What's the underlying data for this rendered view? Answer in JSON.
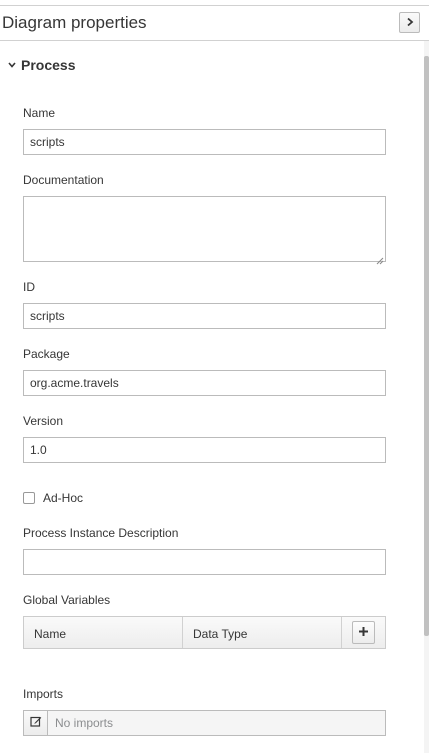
{
  "panel": {
    "title": "Diagram properties",
    "collapse_icon": "chevron-right-icon"
  },
  "section": {
    "title": "Process",
    "toggle_icon": "chevron-down-icon",
    "expanded": true
  },
  "fields": {
    "name": {
      "label": "Name",
      "value": "scripts"
    },
    "documentation": {
      "label": "Documentation",
      "value": ""
    },
    "id": {
      "label": "ID",
      "value": "scripts"
    },
    "package": {
      "label": "Package",
      "value": "org.acme.travels"
    },
    "version": {
      "label": "Version",
      "value": "1.0"
    },
    "adhoc": {
      "label": "Ad-Hoc",
      "checked": false
    },
    "process_instance_description": {
      "label": "Process Instance Description",
      "value": ""
    }
  },
  "global_variables": {
    "label": "Global Variables",
    "columns": [
      "Name",
      "Data Type"
    ],
    "add_icon": "plus-icon"
  },
  "imports": {
    "label": "Imports",
    "value": "No imports",
    "edit_icon": "edit-icon"
  }
}
